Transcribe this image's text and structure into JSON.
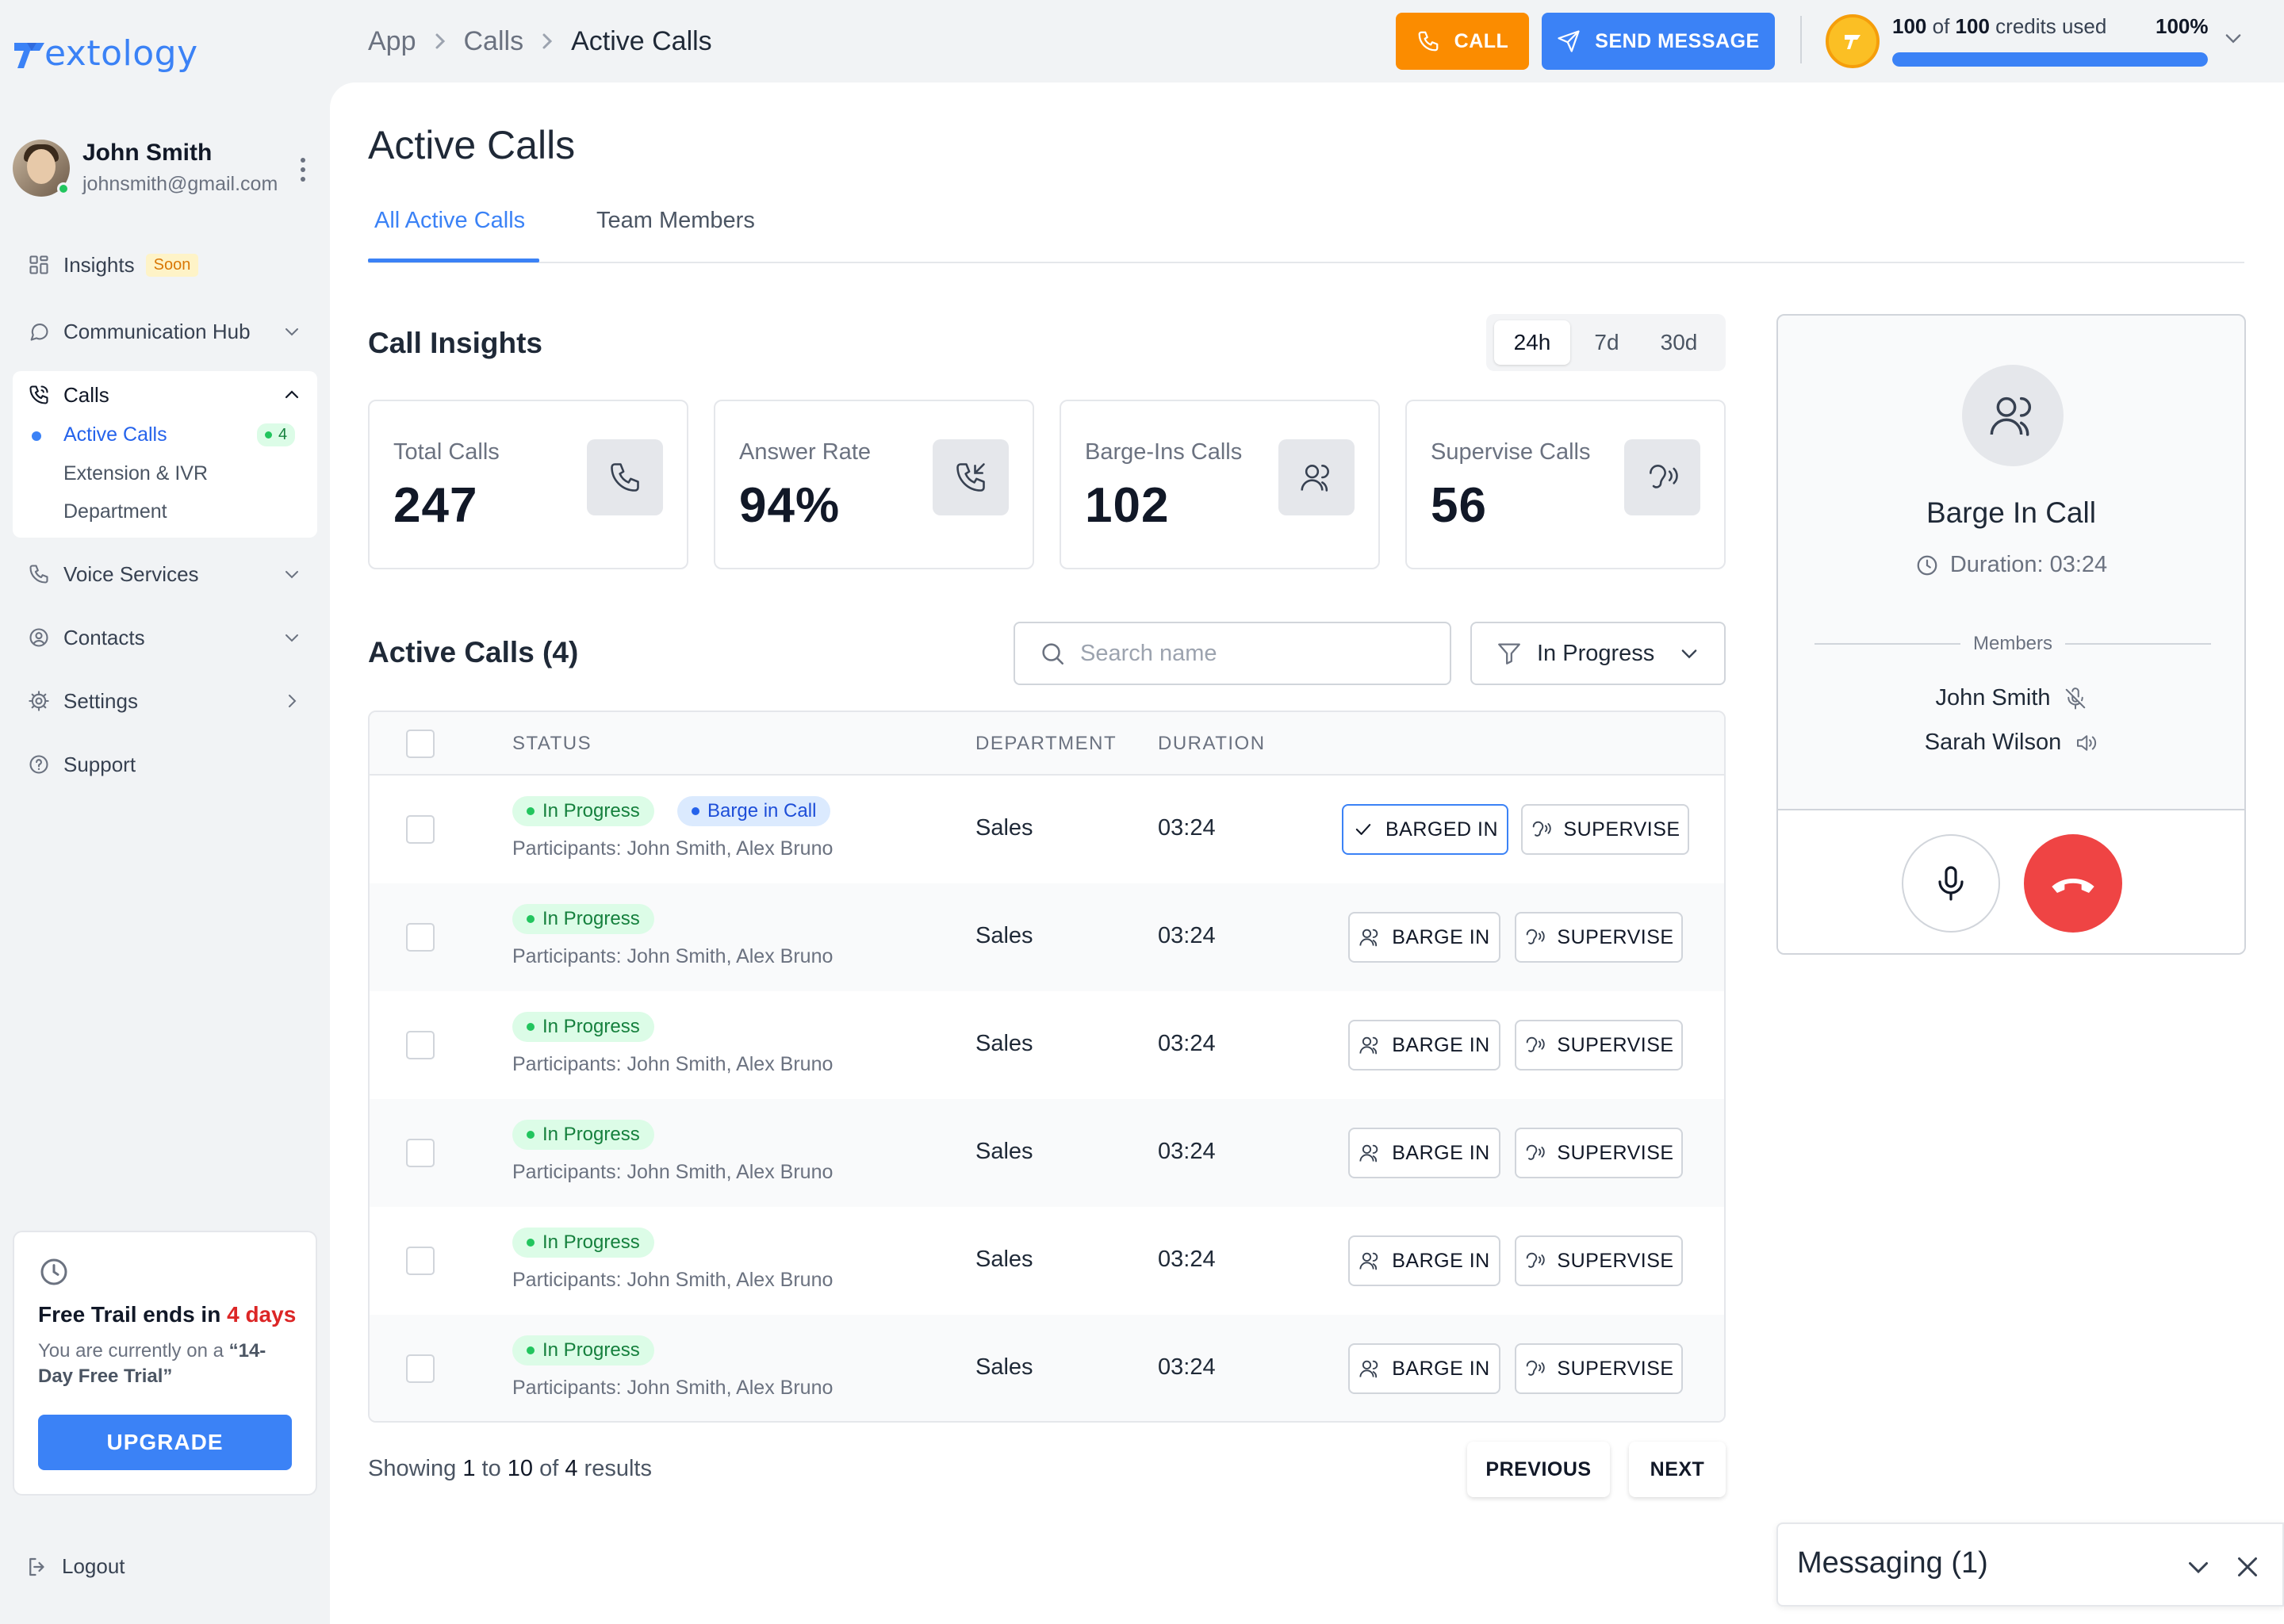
{
  "logo": {
    "text": "extology",
    "mark_color": "#3b82f6"
  },
  "breadcrumb": [
    "App",
    "Calls",
    "Active Calls"
  ],
  "topbar": {
    "call_label": "CALL",
    "send_message_label": "SEND MESSAGE",
    "credits_used": "100",
    "credits_mid": "of",
    "credits_total": "100",
    "credits_suffix": "credits used",
    "credits_percent_label": "100%",
    "credits_fraction": 1.0
  },
  "user": {
    "name": "John Smith",
    "email": "johnsmith@gmail.com",
    "status": "online"
  },
  "sidebar": {
    "insights": {
      "label": "Insights",
      "badge": "Soon",
      "icon": "grid-icon"
    },
    "communication_hub": {
      "label": "Communication Hub",
      "icon": "chat-icon"
    },
    "calls": {
      "label": "Calls",
      "icon": "phone-icon",
      "items": [
        {
          "label": "Active Calls",
          "badge": "4"
        },
        {
          "label": "Extension & IVR"
        },
        {
          "label": "Department"
        }
      ]
    },
    "voice_services": {
      "label": "Voice Services",
      "icon": "phone-icon"
    },
    "contacts": {
      "label": "Contacts",
      "icon": "contact-icon"
    },
    "settings": {
      "label": "Settings",
      "icon": "gear-icon"
    },
    "support": {
      "label": "Support",
      "icon": "help-icon"
    },
    "logout": "Logout"
  },
  "trial": {
    "title_prefix": "Free Trail ends in",
    "title_days": "4 days",
    "text_prefix": "You are currently on a ",
    "text_bold": "“14-Day Free Trial”",
    "upgrade_label": "UPGRADE"
  },
  "page": {
    "title": "Active Calls",
    "tabs": [
      "All Active Calls",
      "Team Members"
    ]
  },
  "insights": {
    "title": "Call Insights",
    "ranges": [
      "24h",
      "7d",
      "30d"
    ],
    "selected_range": "24h",
    "cards": [
      {
        "label": "Total Calls",
        "value": "247",
        "icon": "phone-icon"
      },
      {
        "label": "Answer Rate",
        "value": "94%",
        "icon": "phone-incoming-icon"
      },
      {
        "label": "Barge-Ins Calls",
        "value": "102",
        "icon": "users-icon"
      },
      {
        "label": "Supervise Calls",
        "value": "56",
        "icon": "ear-icon"
      }
    ]
  },
  "calls_list": {
    "title": "Active Calls (4)",
    "search_placeholder": "Search name",
    "filter_value": "In Progress",
    "columns": [
      "STATUS",
      "DEPARTMENT",
      "DURATION"
    ],
    "rows": [
      {
        "status": "In Progress",
        "tag": "Barge in Call",
        "participants": "Participants: John Smith, Alex Bruno",
        "department": "Sales",
        "duration": "03:24",
        "barge_label": "BARGED IN",
        "supervise_label": "SUPERVISE"
      },
      {
        "status": "In Progress",
        "participants": "Participants: John Smith, Alex Bruno",
        "department": "Sales",
        "duration": "03:24",
        "barge_label": "BARGE IN",
        "supervise_label": "SUPERVISE"
      },
      {
        "status": "In Progress",
        "participants": "Participants: John Smith, Alex Bruno",
        "department": "Sales",
        "duration": "03:24",
        "barge_label": "BARGE IN",
        "supervise_label": "SUPERVISE"
      },
      {
        "status": "In Progress",
        "participants": "Participants: John Smith, Alex Bruno",
        "department": "Sales",
        "duration": "03:24",
        "barge_label": "BARGE IN",
        "supervise_label": "SUPERVISE"
      },
      {
        "status": "In Progress",
        "participants": "Participants: John Smith, Alex Bruno",
        "department": "Sales",
        "duration": "03:24",
        "barge_label": "BARGE IN",
        "supervise_label": "SUPERVISE"
      },
      {
        "status": "In Progress",
        "participants": "Participants: John Smith, Alex Bruno",
        "department": "Sales",
        "duration": "03:24",
        "barge_label": "BARGE IN",
        "supervise_label": "SUPERVISE"
      }
    ],
    "pagination": {
      "prefix": "Showing",
      "from": "1",
      "to_word": "to",
      "to": "10",
      "of_word": "of",
      "total": "4",
      "suffix": "results",
      "previous_label": "PREVIOUS",
      "next_label": "NEXT"
    }
  },
  "barge_panel": {
    "title": "Barge In Call",
    "duration_label": "Duration: 03:24",
    "members_label": "Members",
    "members": [
      {
        "name": "John Smith",
        "icon": "mic-off-icon"
      },
      {
        "name": "Sarah Wilson",
        "icon": "speaker-icon"
      }
    ]
  },
  "messaging": {
    "title": "Messaging (1)"
  },
  "colors": {
    "accent": "#3b82f6",
    "call_button": "#fb8c00",
    "hangup": "#ef4444",
    "status_green": "#22c55e",
    "danger_text": "#dc2626"
  }
}
